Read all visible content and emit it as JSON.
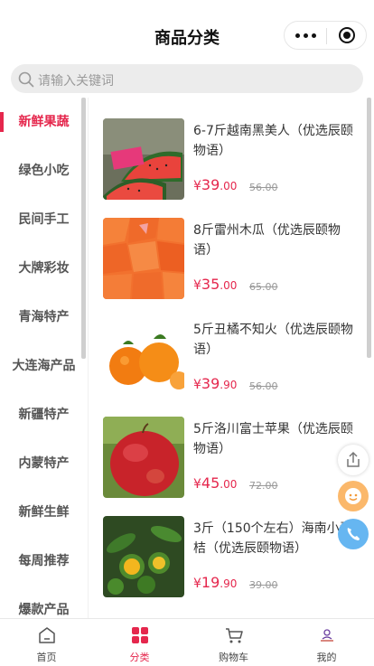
{
  "header": {
    "title": "商品分类"
  },
  "search": {
    "placeholder": "请输入关键词"
  },
  "sidebar": {
    "items": [
      {
        "label": "新鲜果蔬",
        "active": true
      },
      {
        "label": "绿色小吃"
      },
      {
        "label": "民间手工"
      },
      {
        "label": "大牌彩妆"
      },
      {
        "label": "青海特产"
      },
      {
        "label": "大连海产品"
      },
      {
        "label": "新疆特产"
      },
      {
        "label": "内蒙特产"
      },
      {
        "label": "新鲜生鲜"
      },
      {
        "label": "每周推荐"
      },
      {
        "label": "爆款产品"
      }
    ]
  },
  "products": [
    {
      "name": "6-7斤越南黑美人（优选辰颐物语）",
      "currency": "¥",
      "price_int": "39",
      "price_dec": ".00",
      "old_price": "56.00"
    },
    {
      "name": "8斤雷州木瓜（优选辰颐物语）",
      "currency": "¥",
      "price_int": "35",
      "price_dec": ".00",
      "old_price": "65.00"
    },
    {
      "name": "5斤丑橘不知火（优选辰颐物语）",
      "currency": "¥",
      "price_int": "39",
      "price_dec": ".90",
      "old_price": "56.00"
    },
    {
      "name": "5斤洛川富士苹果（优选辰颐物语）",
      "currency": "¥",
      "price_int": "45",
      "price_dec": ".00",
      "old_price": "72.00"
    },
    {
      "name": "3斤（150个左右）海南小青桔（优选辰颐物语）",
      "currency": "¥",
      "price_int": "19",
      "price_dec": ".90",
      "old_price": "39.00"
    }
  ],
  "tabbar": {
    "tabs": [
      {
        "label": "首页",
        "icon": "home-icon"
      },
      {
        "label": "分类",
        "icon": "category-icon",
        "active": true
      },
      {
        "label": "购物车",
        "icon": "cart-icon"
      },
      {
        "label": "我的",
        "icon": "profile-icon"
      }
    ]
  },
  "colors": {
    "accent": "#e5274d",
    "search_bg": "#ececec",
    "chat_fab": "#fbb86b",
    "phone_fab": "#66b6f1"
  }
}
